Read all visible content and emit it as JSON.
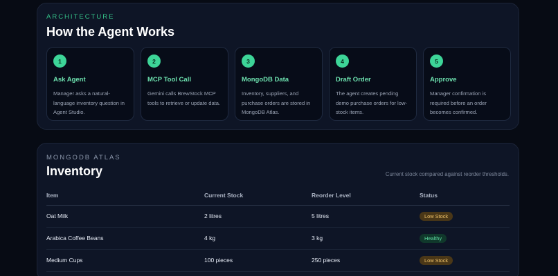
{
  "architecture": {
    "eyebrow": "Architecture",
    "title": "How the Agent Works",
    "steps": [
      {
        "number": "1",
        "title": "Ask Agent",
        "description": "Manager asks a natural-language inventory question in Agent Studio."
      },
      {
        "number": "2",
        "title": "MCP Tool Call",
        "description": "Gemini calls BrewStock MCP tools to retrieve or update data."
      },
      {
        "number": "3",
        "title": "MongoDB Data",
        "description": "Inventory, suppliers, and purchase orders are stored in MongoDB Atlas."
      },
      {
        "number": "4",
        "title": "Draft Order",
        "description": "The agent creates pending demo purchase orders for low-stock items."
      },
      {
        "number": "5",
        "title": "Approve",
        "description": "Manager confirmation is required before an order becomes confirmed."
      }
    ]
  },
  "inventory": {
    "eyebrow": "MongoDB Atlas",
    "title": "Inventory",
    "subtitle": "Current stock compared against reorder thresholds.",
    "columns": [
      "Item",
      "Current Stock",
      "Reorder Level",
      "Status"
    ],
    "rows": [
      {
        "item": "Oat Milk",
        "current": "2 litres",
        "reorder": "5 litres",
        "status": "Low Stock"
      },
      {
        "item": "Arabica Coffee Beans",
        "current": "4 kg",
        "reorder": "3 kg",
        "status": "Healthy"
      },
      {
        "item": "Medium Cups",
        "current": "100 pieces",
        "reorder": "250 pieces",
        "status": "Low Stock"
      }
    ]
  },
  "colors": {
    "accent": "#3dd598",
    "low_stock": "#f0c36a",
    "healthy": "#5fdca3",
    "background": "#070b14"
  }
}
